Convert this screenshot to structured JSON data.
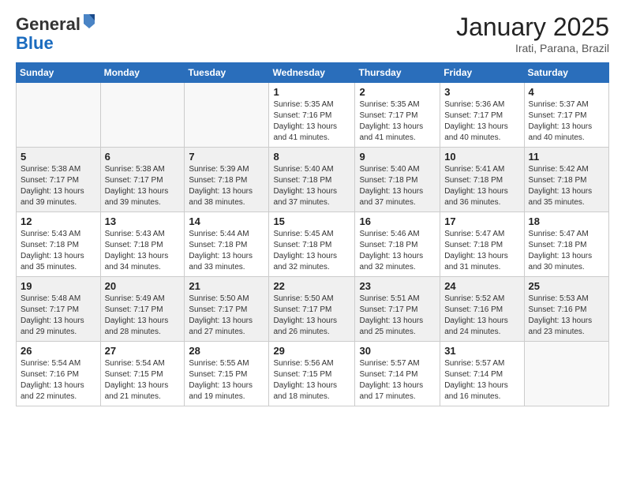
{
  "logo": {
    "general": "General",
    "blue": "Blue"
  },
  "header": {
    "title": "January 2025",
    "subtitle": "Irati, Parana, Brazil"
  },
  "weekdays": [
    "Sunday",
    "Monday",
    "Tuesday",
    "Wednesday",
    "Thursday",
    "Friday",
    "Saturday"
  ],
  "weeks": [
    [
      {
        "day": "",
        "sunrise": "",
        "sunset": "",
        "daylight": ""
      },
      {
        "day": "",
        "sunrise": "",
        "sunset": "",
        "daylight": ""
      },
      {
        "day": "",
        "sunrise": "",
        "sunset": "",
        "daylight": ""
      },
      {
        "day": "1",
        "sunrise": "Sunrise: 5:35 AM",
        "sunset": "Sunset: 7:16 PM",
        "daylight": "Daylight: 13 hours and 41 minutes."
      },
      {
        "day": "2",
        "sunrise": "Sunrise: 5:35 AM",
        "sunset": "Sunset: 7:17 PM",
        "daylight": "Daylight: 13 hours and 41 minutes."
      },
      {
        "day": "3",
        "sunrise": "Sunrise: 5:36 AM",
        "sunset": "Sunset: 7:17 PM",
        "daylight": "Daylight: 13 hours and 40 minutes."
      },
      {
        "day": "4",
        "sunrise": "Sunrise: 5:37 AM",
        "sunset": "Sunset: 7:17 PM",
        "daylight": "Daylight: 13 hours and 40 minutes."
      }
    ],
    [
      {
        "day": "5",
        "sunrise": "Sunrise: 5:38 AM",
        "sunset": "Sunset: 7:17 PM",
        "daylight": "Daylight: 13 hours and 39 minutes."
      },
      {
        "day": "6",
        "sunrise": "Sunrise: 5:38 AM",
        "sunset": "Sunset: 7:17 PM",
        "daylight": "Daylight: 13 hours and 39 minutes."
      },
      {
        "day": "7",
        "sunrise": "Sunrise: 5:39 AM",
        "sunset": "Sunset: 7:18 PM",
        "daylight": "Daylight: 13 hours and 38 minutes."
      },
      {
        "day": "8",
        "sunrise": "Sunrise: 5:40 AM",
        "sunset": "Sunset: 7:18 PM",
        "daylight": "Daylight: 13 hours and 37 minutes."
      },
      {
        "day": "9",
        "sunrise": "Sunrise: 5:40 AM",
        "sunset": "Sunset: 7:18 PM",
        "daylight": "Daylight: 13 hours and 37 minutes."
      },
      {
        "day": "10",
        "sunrise": "Sunrise: 5:41 AM",
        "sunset": "Sunset: 7:18 PM",
        "daylight": "Daylight: 13 hours and 36 minutes."
      },
      {
        "day": "11",
        "sunrise": "Sunrise: 5:42 AM",
        "sunset": "Sunset: 7:18 PM",
        "daylight": "Daylight: 13 hours and 35 minutes."
      }
    ],
    [
      {
        "day": "12",
        "sunrise": "Sunrise: 5:43 AM",
        "sunset": "Sunset: 7:18 PM",
        "daylight": "Daylight: 13 hours and 35 minutes."
      },
      {
        "day": "13",
        "sunrise": "Sunrise: 5:43 AM",
        "sunset": "Sunset: 7:18 PM",
        "daylight": "Daylight: 13 hours and 34 minutes."
      },
      {
        "day": "14",
        "sunrise": "Sunrise: 5:44 AM",
        "sunset": "Sunset: 7:18 PM",
        "daylight": "Daylight: 13 hours and 33 minutes."
      },
      {
        "day": "15",
        "sunrise": "Sunrise: 5:45 AM",
        "sunset": "Sunset: 7:18 PM",
        "daylight": "Daylight: 13 hours and 32 minutes."
      },
      {
        "day": "16",
        "sunrise": "Sunrise: 5:46 AM",
        "sunset": "Sunset: 7:18 PM",
        "daylight": "Daylight: 13 hours and 32 minutes."
      },
      {
        "day": "17",
        "sunrise": "Sunrise: 5:47 AM",
        "sunset": "Sunset: 7:18 PM",
        "daylight": "Daylight: 13 hours and 31 minutes."
      },
      {
        "day": "18",
        "sunrise": "Sunrise: 5:47 AM",
        "sunset": "Sunset: 7:18 PM",
        "daylight": "Daylight: 13 hours and 30 minutes."
      }
    ],
    [
      {
        "day": "19",
        "sunrise": "Sunrise: 5:48 AM",
        "sunset": "Sunset: 7:17 PM",
        "daylight": "Daylight: 13 hours and 29 minutes."
      },
      {
        "day": "20",
        "sunrise": "Sunrise: 5:49 AM",
        "sunset": "Sunset: 7:17 PM",
        "daylight": "Daylight: 13 hours and 28 minutes."
      },
      {
        "day": "21",
        "sunrise": "Sunrise: 5:50 AM",
        "sunset": "Sunset: 7:17 PM",
        "daylight": "Daylight: 13 hours and 27 minutes."
      },
      {
        "day": "22",
        "sunrise": "Sunrise: 5:50 AM",
        "sunset": "Sunset: 7:17 PM",
        "daylight": "Daylight: 13 hours and 26 minutes."
      },
      {
        "day": "23",
        "sunrise": "Sunrise: 5:51 AM",
        "sunset": "Sunset: 7:17 PM",
        "daylight": "Daylight: 13 hours and 25 minutes."
      },
      {
        "day": "24",
        "sunrise": "Sunrise: 5:52 AM",
        "sunset": "Sunset: 7:16 PM",
        "daylight": "Daylight: 13 hours and 24 minutes."
      },
      {
        "day": "25",
        "sunrise": "Sunrise: 5:53 AM",
        "sunset": "Sunset: 7:16 PM",
        "daylight": "Daylight: 13 hours and 23 minutes."
      }
    ],
    [
      {
        "day": "26",
        "sunrise": "Sunrise: 5:54 AM",
        "sunset": "Sunset: 7:16 PM",
        "daylight": "Daylight: 13 hours and 22 minutes."
      },
      {
        "day": "27",
        "sunrise": "Sunrise: 5:54 AM",
        "sunset": "Sunset: 7:15 PM",
        "daylight": "Daylight: 13 hours and 21 minutes."
      },
      {
        "day": "28",
        "sunrise": "Sunrise: 5:55 AM",
        "sunset": "Sunset: 7:15 PM",
        "daylight": "Daylight: 13 hours and 19 minutes."
      },
      {
        "day": "29",
        "sunrise": "Sunrise: 5:56 AM",
        "sunset": "Sunset: 7:15 PM",
        "daylight": "Daylight: 13 hours and 18 minutes."
      },
      {
        "day": "30",
        "sunrise": "Sunrise: 5:57 AM",
        "sunset": "Sunset: 7:14 PM",
        "daylight": "Daylight: 13 hours and 17 minutes."
      },
      {
        "day": "31",
        "sunrise": "Sunrise: 5:57 AM",
        "sunset": "Sunset: 7:14 PM",
        "daylight": "Daylight: 13 hours and 16 minutes."
      },
      {
        "day": "",
        "sunrise": "",
        "sunset": "",
        "daylight": ""
      }
    ]
  ]
}
